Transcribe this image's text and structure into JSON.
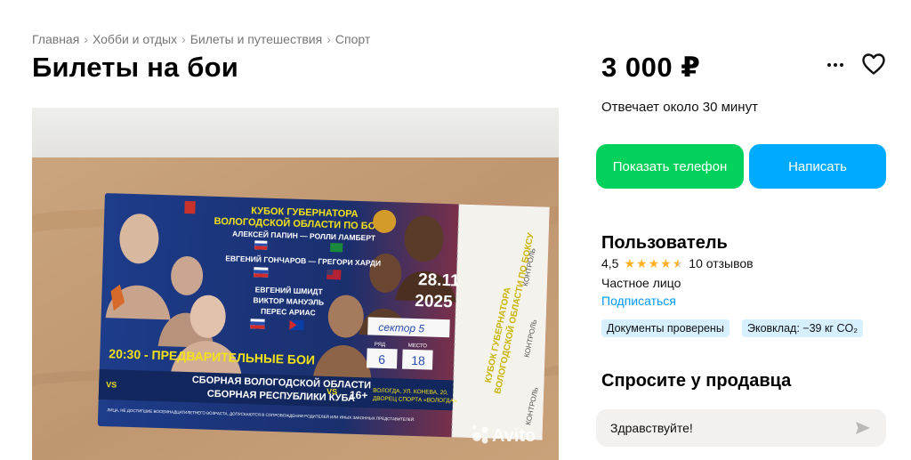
{
  "breadcrumb": [
    {
      "label": "Главная"
    },
    {
      "label": "Хобби и отдых"
    },
    {
      "label": "Билеты и путешествия"
    },
    {
      "label": "Спорт"
    }
  ],
  "breadcrumb_separator": "›",
  "title": "Билеты на бои",
  "price": "3 000 ₽",
  "response_time": "Отвечает около 30 минут",
  "buttons": {
    "show_phone": "Показать телефон",
    "write": "Написать"
  },
  "seller": {
    "name": "Пользователь",
    "rating": "4,5",
    "rating_value": 4.5,
    "reviews": "10 отзывов",
    "type": "Частное лицо",
    "subscribe": "Подписаться"
  },
  "badges": {
    "docs": "Документы проверены",
    "eco": "Эковклад: −39 кг CO₂"
  },
  "ask": {
    "title": "Спросите у продавца",
    "message": "Здравствуйте!"
  },
  "ticket": {
    "header_line1": "КУБОК ГУБЕРНАТОРА",
    "header_line2": "ВОЛОГОДСКОЙ ОБЛАСТИ ПО БОКСУ",
    "fight1": "АЛЕКСЕЙ ПАПИН — РОЛЛИ ЛАМБЕРТ",
    "fight2": "ЕВГЕНИЙ ГОНЧАРОВ — ГРЕГОРИ ХАРДИ",
    "fight3_a": "ЕВГЕНИЙ ШМИДТ",
    "fight3_b": "ВИКТОР МАНУЭЛЬ",
    "fight3_c": "ПЕРЕС АРИАС",
    "date": "28.11",
    "year": "2025",
    "sector_handwritten": "сектор 5",
    "row_label": "РЯД",
    "row_value": "6",
    "seat_label": "МЕСТО",
    "seat_value": "18",
    "prelim": "20:30 - ПРЕДВАРИТЕЛЬНЫЕ БОИ",
    "teams_line1": "СБОРНАЯ ВОЛОГОДСКОЙ ОБЛАСТИ",
    "teams_line2": "СБОРНАЯ РЕСПУБЛИКИ КУБА",
    "vs": "VS",
    "age": "16+",
    "venue_line1": "ВОЛОГДА, УЛ. КОНЕВА, 20,",
    "venue_line2": "ДВОРЕЦ СПОРТА «ВОЛОГДА»",
    "disclaimer": "ЛИЦА, НЕ ДОСТИГШИЕ ВОСЕМНАДЦАТИЛЕТНЕГО ВОЗРАСТА, ДОПУСКАЮТСЯ В СОПРОВОЖДЕНИИ РОДИТЕЛЕЙ ИЛИ ИНЫХ ЗАКОННЫХ ПРЕДСТАВИТЕЛЕЙ.",
    "stub_line1": "КУБОК ГУБЕРНАТОРА",
    "stub_line2": "ВОЛОГОДСКОЙ ОБЛАСТИ ПО БОКСУ",
    "control": "КОНТРОЛЬ"
  },
  "watermark": "Avito",
  "colors": {
    "green": "#02d15c",
    "blue": "#00aaff",
    "link": "#0099f7",
    "badge_bg": "#d6f0ff",
    "star": "#ffb021",
    "ticket_yellow": "#f2e21a"
  }
}
